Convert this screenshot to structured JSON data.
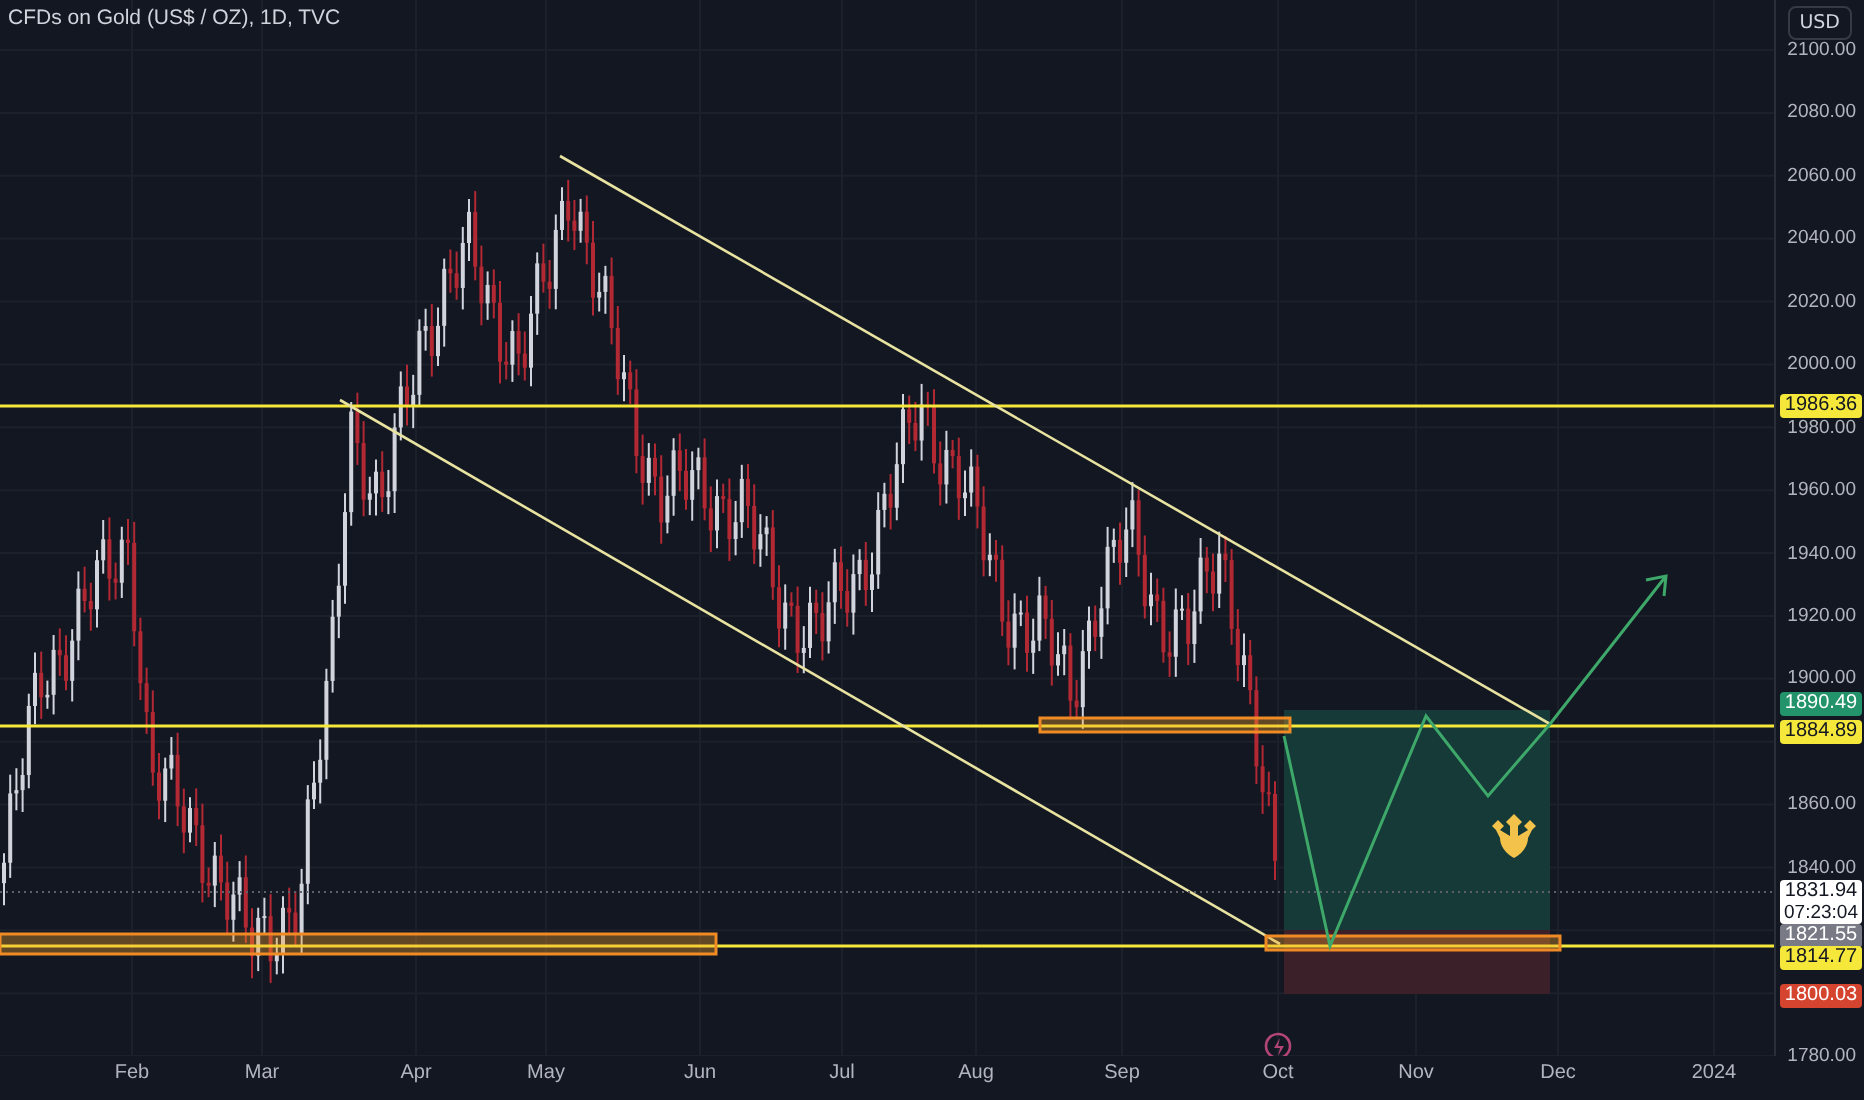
{
  "chart": {
    "title": "CFDs on Gold (US$ / OZ), 1D, TVC",
    "currency_button": "USD",
    "price_ticks": [
      "2100.00",
      "2080.00",
      "2060.00",
      "2040.00",
      "2020.00",
      "2000.00",
      "1980.00",
      "1960.00",
      "1940.00",
      "1920.00",
      "1900.00",
      "1860.00",
      "1840.00",
      "1780.00"
    ],
    "time_labels": [
      "Feb",
      "Mar",
      "Apr",
      "May",
      "Jun",
      "Jul",
      "Aug",
      "Sep",
      "Oct",
      "Nov",
      "Dec",
      "2024"
    ],
    "price_tags": [
      {
        "text": "1986.36",
        "color": "#f5e83b"
      },
      {
        "text": "1890.49",
        "color": "#22936b"
      },
      {
        "text": "1884.89",
        "color": "#f5e83b"
      },
      {
        "text": "1831.94",
        "sub": "07:23:04",
        "color": "#ffffff"
      },
      {
        "text": "1821.55",
        "color": "#787b86"
      },
      {
        "text": "1814.77",
        "color": "#f5e83b"
      },
      {
        "text": "1800.03",
        "color": "#d4442f"
      }
    ]
  }
}
